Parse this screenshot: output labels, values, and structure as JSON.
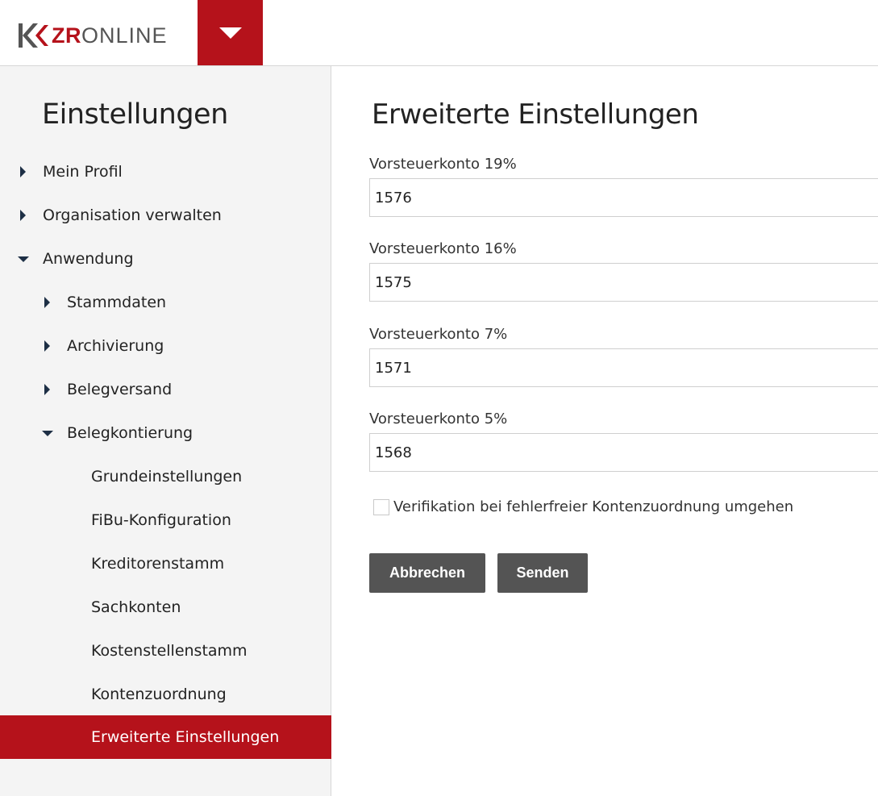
{
  "logo": {
    "brand_zr": "ZR",
    "brand_online": "ONLINE"
  },
  "colors": {
    "brand_red": "#b5121b",
    "button_gray": "#545454",
    "sidebar_bg": "#f4f4f4",
    "arrow_navy": "#1d2f45"
  },
  "sidebar": {
    "title": "Einstellungen",
    "items": [
      {
        "label": "Mein Profil",
        "state": "collapsed"
      },
      {
        "label": "Organisation verwalten",
        "state": "collapsed"
      },
      {
        "label": "Anwendung",
        "state": "expanded"
      },
      {
        "label": "Stammdaten",
        "state": "collapsed"
      },
      {
        "label": "Archivierung",
        "state": "collapsed"
      },
      {
        "label": "Belegversand",
        "state": "collapsed"
      },
      {
        "label": "Belegkontierung",
        "state": "expanded"
      },
      {
        "label": "Grundeinstellungen"
      },
      {
        "label": "FiBu-Konfiguration"
      },
      {
        "label": "Kreditorenstamm"
      },
      {
        "label": "Sachkonten"
      },
      {
        "label": "Kostenstellenstamm"
      },
      {
        "label": "Kontenzuordnung"
      },
      {
        "label": "Erweiterte Einstellungen",
        "active": true
      }
    ]
  },
  "main": {
    "title": "Erweiterte Einstellungen",
    "fields": [
      {
        "label": "Vorsteuerkonto 19%",
        "value": "1576"
      },
      {
        "label": "Vorsteuerkonto 16%",
        "value": "1575"
      },
      {
        "label": "Vorsteuerkonto 7%",
        "value": "1571"
      },
      {
        "label": "Vorsteuerkonto 5%",
        "value": "1568"
      }
    ],
    "checkbox": {
      "label": "Verifikation bei fehlerfreier Kontenzuordnung umgehen",
      "checked": false
    },
    "buttons": {
      "cancel": "Abbrechen",
      "send": "Senden"
    }
  }
}
